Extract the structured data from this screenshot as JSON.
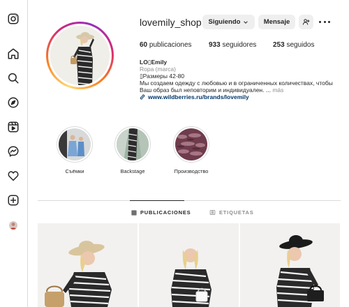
{
  "profile": {
    "username": "lovemily_shop",
    "buttons": {
      "following": "Siguiendo",
      "message": "Mensaje"
    },
    "stats": {
      "posts_count": "60",
      "posts_label": "publicaciones",
      "followers_count": "933",
      "followers_label": "seguidores",
      "following_count": "253",
      "following_label": "seguidos"
    },
    "bio": {
      "name": "LO▯Emily",
      "category": "Ropa (marca)",
      "line1": "▯Размеры 42-80",
      "line2": "Мы создаем одежду с любовью и в ограниченных количествах, чтобы",
      "line3": "Ваш образ был неповторим и индивидуален. ...",
      "more": "más",
      "link": "www.wildberries.ru/brands/lovemily"
    }
  },
  "highlights": [
    {
      "label": "Съёмки"
    },
    {
      "label": "Backstage"
    },
    {
      "label": "Производство"
    }
  ],
  "tabs": [
    {
      "label": "PUBLICACIONES",
      "icon": "grid-icon",
      "active": true
    },
    {
      "label": "ETIQUETAS",
      "icon": "tag-icon",
      "active": false
    }
  ],
  "sidebar": {
    "items": [
      "instagram-logo-icon",
      "home-icon",
      "search-icon",
      "explore-icon",
      "reels-icon",
      "messenger-icon",
      "heart-icon",
      "create-icon",
      "profile-avatar"
    ]
  },
  "colors": {
    "link": "#00376b",
    "button_bg": "#efefef",
    "muted": "#8e8e8e",
    "border": "#dbdbdb"
  }
}
